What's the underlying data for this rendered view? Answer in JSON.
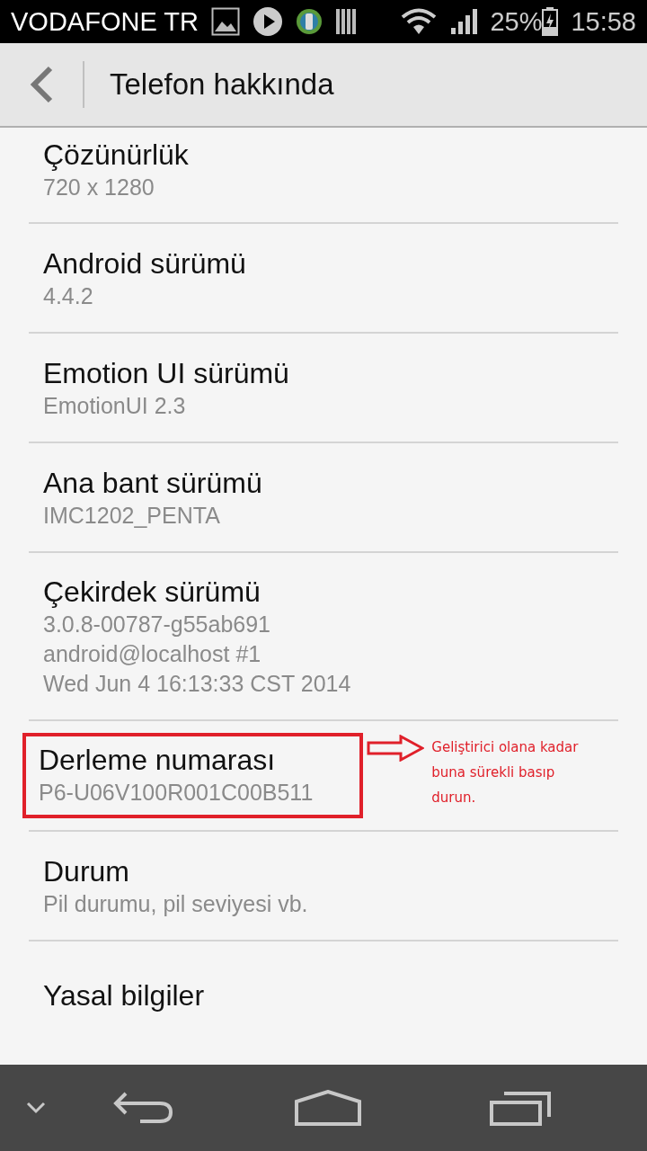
{
  "status_bar": {
    "carrier": "VODAFONE TR",
    "battery": "25%",
    "time": "15:58"
  },
  "header": {
    "title": "Telefon hakkında"
  },
  "items": [
    {
      "title": "Çözünürlük",
      "lines": [
        "720 x 1280"
      ],
      "highlighted": false
    },
    {
      "title": "Android sürümü",
      "lines": [
        "4.4.2"
      ],
      "highlighted": false
    },
    {
      "title": "Emotion UI sürümü",
      "lines": [
        "EmotionUI 2.3"
      ],
      "highlighted": false
    },
    {
      "title": "Ana bant sürümü",
      "lines": [
        "IMC1202_PENTA"
      ],
      "highlighted": false
    },
    {
      "title": "Çekirdek sürümü",
      "lines": [
        "3.0.8-00787-g55ab691",
        "android@localhost #1",
        "Wed Jun 4 16:13:33 CST 2014"
      ],
      "highlighted": false
    },
    {
      "title": "Derleme numarası",
      "lines": [
        "P6-U06V100R001C00B511"
      ],
      "highlighted": true,
      "note": "Geliştirici olana kadar buna sürekli basıp durun."
    },
    {
      "title": "Durum",
      "lines": [
        "Pil durumu, pil seviyesi vb."
      ],
      "highlighted": false
    },
    {
      "title": "Yasal bilgiler",
      "highlighted": false
    }
  ]
}
